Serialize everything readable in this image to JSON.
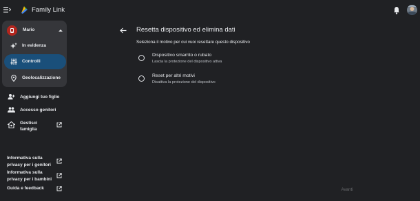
{
  "header": {
    "menu_icon": "hamburger-menu-icon",
    "logo_icon": "family-link-logo",
    "app_title": "Family Link",
    "bell_icon": "notifications-bell-icon",
    "account_icon": "account-avatar"
  },
  "sidebar": {
    "child_name": "Mario",
    "nav_items": [
      {
        "label": "In evidenza",
        "icon": "sparkle-icon"
      },
      {
        "label": "Controlli",
        "icon": "sliders-icon",
        "active": true
      },
      {
        "label": "Geolocalizzazione",
        "icon": "location-pin-icon"
      }
    ],
    "links": [
      {
        "label": "Aggiungi tuo figlio",
        "icon": "add-person-icon"
      },
      {
        "label": "Accesso genitori",
        "icon": "group-icon"
      },
      {
        "label": "Gestisci famiglia",
        "icon": "home-icon",
        "external": true
      }
    ],
    "footer_links": [
      {
        "label": "Informativa sulla privacy per i genitori"
      },
      {
        "label": "Informativa sulla privacy per i bambini"
      },
      {
        "label": "Guida e feedback"
      }
    ]
  },
  "main": {
    "title": "Resetta dispositivo ed elimina dati",
    "subtitle": "Seleziona il motivo per cui vuoi resettare questo dispositivo",
    "options": [
      {
        "title": "Dispositivo smarrito o rubato",
        "description": "Lascia la protezione del dispositivo attiva"
      },
      {
        "title": "Reset per altri motivi",
        "description": "Disattiva la protezione del dispositivo"
      }
    ],
    "next_label": "Avanti"
  },
  "colors": {
    "background": "#202124",
    "card": "#35363a",
    "active_nav": "#1a4f7a",
    "text": "#e8eaed",
    "disabled": "#6b6d70"
  }
}
